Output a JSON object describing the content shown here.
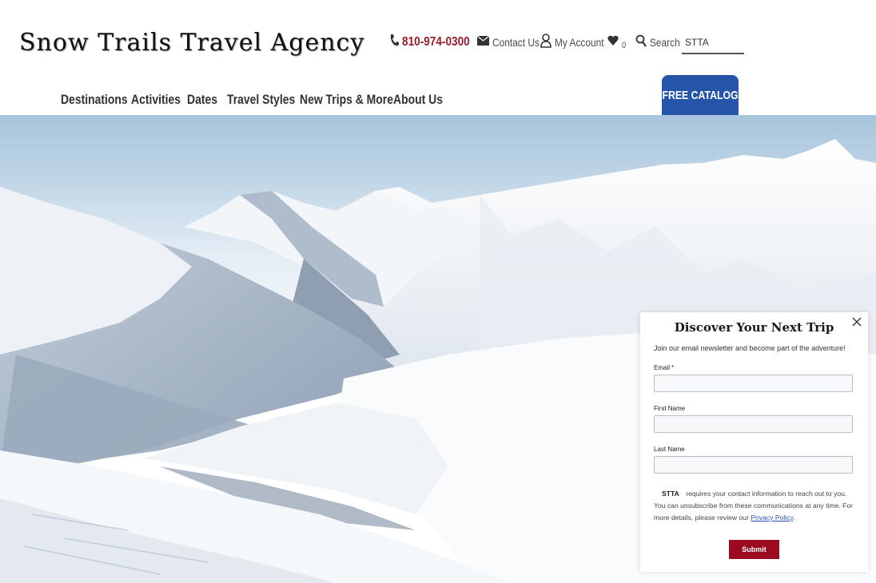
{
  "header": {
    "site_title": "Snow Trails Travel Agency",
    "phone": "810-974-0300",
    "contact_label": "Contact Us",
    "account_label": "My Account",
    "favorites_count": "0",
    "search_label": "Search",
    "search_value": "STTA"
  },
  "nav": {
    "items": [
      {
        "label": "Destinations"
      },
      {
        "label": "Activities"
      },
      {
        "label": "Dates"
      },
      {
        "label": "Travel Styles"
      },
      {
        "label": "New Trips & More"
      },
      {
        "label": "About Us"
      }
    ],
    "catalog_button": "FREE CATALOG"
  },
  "popup": {
    "title": "Discover Your Next Trip",
    "subtitle": "Join our email newsletter and become part of the adventure!",
    "email_label": "Email",
    "required_mark": "*",
    "first_name_label": "First Name",
    "last_name_label": "Last Name",
    "consent_brand": "STTA",
    "consent_text": "requires your contact information to reach out to you. You can unsubscribe from these communications at any time. For more details, please review our",
    "privacy_link": "Privacy Policy",
    "consent_end": ".",
    "submit_label": "Submit"
  },
  "colors": {
    "phone": "#9b1a2e",
    "catalog_bg": "#2554a8",
    "submit_bg": "#9b0a1f",
    "link": "#2e4fbf"
  },
  "icons": [
    "phone-icon",
    "envelope-icon",
    "user-icon",
    "heart-icon",
    "search-icon",
    "close-icon"
  ]
}
